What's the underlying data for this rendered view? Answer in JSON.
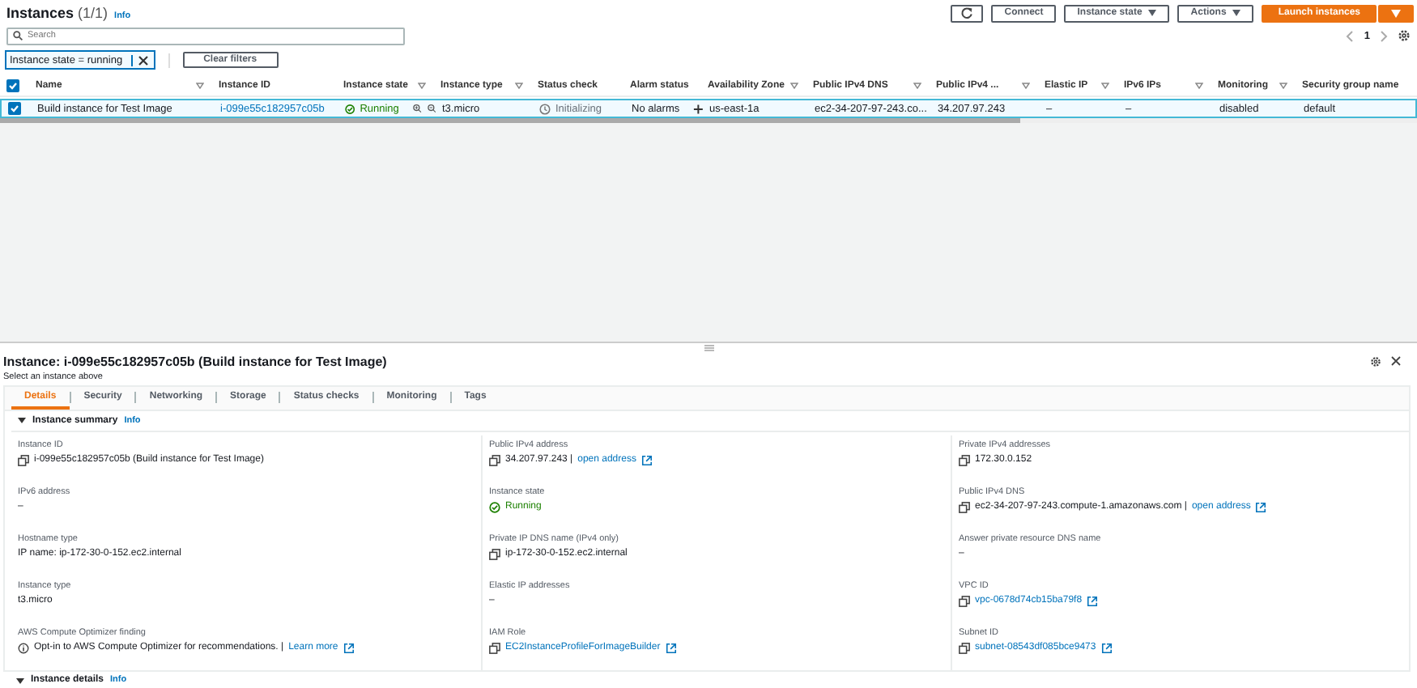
{
  "header": {
    "title": "Instances",
    "count": "(1/1)",
    "info": "Info"
  },
  "buttons": [
    {
      "kind": "icon"
    },
    {
      "kind": "plain",
      "label": "Connect"
    },
    {
      "kind": "menu",
      "label": "Instance state"
    },
    {
      "kind": "menu",
      "label": "Actions"
    },
    {
      "kind": "primary",
      "label": "Launch instances"
    }
  ],
  "search": {
    "placeholder": "Search"
  },
  "filter": {
    "chip": "Instance state = running",
    "clear": "Clear filters"
  },
  "pagination": {
    "page": "1"
  },
  "table": {
    "all_checked": true,
    "columns": [
      {
        "label": "Name",
        "filter": true
      },
      {
        "label": "Instance ID",
        "filter": false
      },
      {
        "label": "Instance state",
        "filter": true
      },
      {
        "label": "Instance type",
        "filter": true
      },
      {
        "label": "Status check",
        "filter": false
      },
      {
        "label": "Alarm status",
        "filter": false
      },
      {
        "label": "Availability Zone",
        "filter": true
      },
      {
        "label": "Public IPv4 DNS",
        "filter": true
      },
      {
        "label": "Public IPv4 ...",
        "filter": true
      },
      {
        "label": "Elastic IP",
        "filter": true
      },
      {
        "label": "IPv6 IPs",
        "filter": true
      },
      {
        "label": "Monitoring",
        "filter": true
      },
      {
        "label": "Security group name",
        "filter": false
      }
    ],
    "rows": [
      {
        "checked": true,
        "selected": true,
        "cells": [
          {
            "kind": "text",
            "text": "Build instance for Test Image"
          },
          {
            "kind": "link",
            "text": "i-099e55c182957c05b"
          },
          {
            "kind": "status",
            "text": "Running"
          },
          {
            "kind": "text",
            "text": "t3.micro"
          },
          {
            "kind": "pending",
            "text": "Initializing"
          },
          {
            "kind": "alarm",
            "text": "No alarms"
          },
          {
            "kind": "text",
            "text": "us-east-1a"
          },
          {
            "kind": "text",
            "text": "ec2-34-207-97-243.co..."
          },
          {
            "kind": "text",
            "text": "34.207.97.243"
          },
          {
            "kind": "text",
            "text": "–"
          },
          {
            "kind": "text",
            "text": "–"
          },
          {
            "kind": "text",
            "text": "disabled"
          },
          {
            "kind": "text",
            "text": "default"
          }
        ]
      }
    ]
  },
  "detail": {
    "title": "Instance: i-099e55c182957c05b (Build instance for Test Image)",
    "hint": "Select an instance above",
    "tabs": [
      {
        "label": "Details",
        "selected": true
      },
      {
        "label": "Security",
        "selected": false
      },
      {
        "label": "Networking",
        "selected": false
      },
      {
        "label": "Storage",
        "selected": false
      },
      {
        "label": "Status checks",
        "selected": false
      },
      {
        "label": "Monitoring",
        "selected": false
      },
      {
        "label": "Tags",
        "selected": false
      }
    ],
    "summary": {
      "title": "Instance summary",
      "info": "Info",
      "expanded": true,
      "columns": [
        [
          {
            "label": "Instance ID",
            "kind": "copy",
            "text": "i-099e55c182957c05b (Build instance for Test Image)"
          },
          {
            "label": "IPv6 address",
            "kind": "text",
            "text": "–"
          },
          {
            "label": "Hostname type",
            "kind": "text",
            "text": "IP name: ip-172-30-0-152.ec2.internal"
          },
          {
            "label": "Instance type",
            "kind": "text",
            "text": "t3.micro"
          },
          {
            "label": "AWS Compute Optimizer finding",
            "kind": "info",
            "text": "Opt-in to AWS Compute Optimizer for recommendations. |",
            "link": "Learn more"
          }
        ],
        [
          {
            "label": "Public IPv4 address",
            "kind": "copy",
            "text": "34.207.97.243 |",
            "link": "open address"
          },
          {
            "label": "Instance state",
            "kind": "status",
            "text": "Running"
          },
          {
            "label": "Private IP DNS name (IPv4 only)",
            "kind": "copy",
            "text": "ip-172-30-0-152.ec2.internal"
          },
          {
            "label": "Elastic IP addresses",
            "kind": "text",
            "text": "–"
          },
          {
            "label": "IAM Role",
            "kind": "copy",
            "link": "EC2InstanceProfileForImageBuilder"
          }
        ],
        [
          {
            "label": "Private IPv4 addresses",
            "kind": "copy",
            "text": "172.30.0.152"
          },
          {
            "label": "Public IPv4 DNS",
            "kind": "copy",
            "text": "ec2-34-207-97-243.compute-1.amazonaws.com |",
            "link": "open address"
          },
          {
            "label": "Answer private resource DNS name",
            "kind": "text",
            "text": "–"
          },
          {
            "label": "VPC ID",
            "kind": "copy",
            "link": "vpc-0678d74cb15ba79f8"
          },
          {
            "label": "Subnet ID",
            "kind": "copy",
            "link": "subnet-08543df085bce9473"
          }
        ]
      ]
    },
    "next_section": {
      "title": "Instance details",
      "info": "Info",
      "expanded": true
    }
  }
}
